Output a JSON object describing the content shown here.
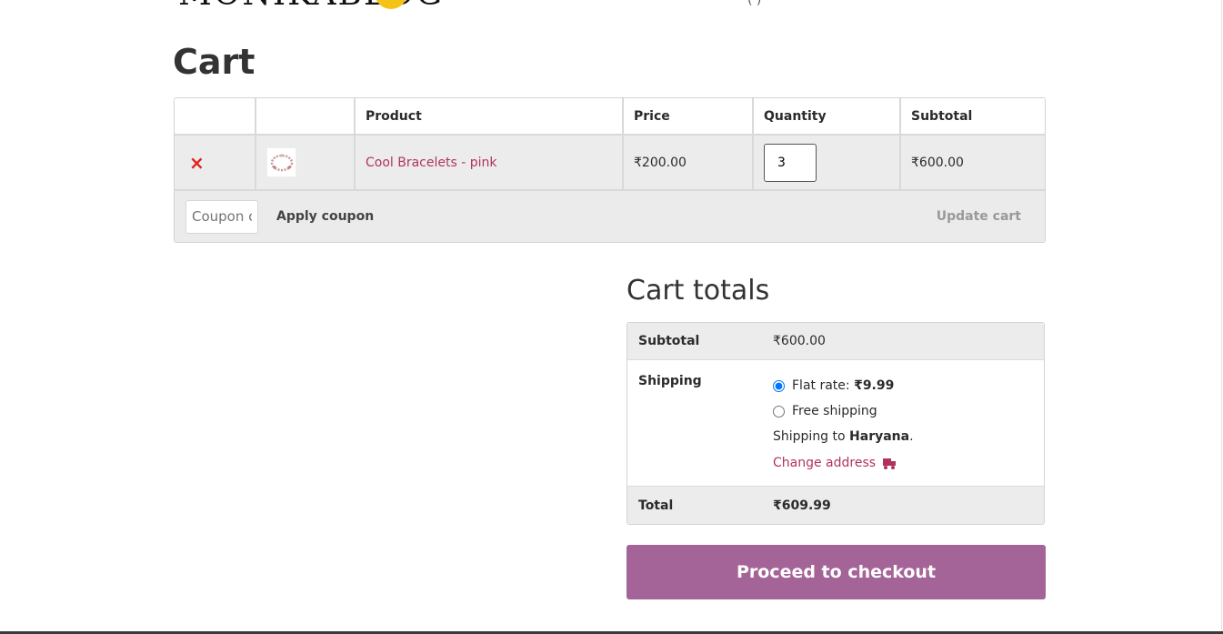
{
  "header": {
    "logo_text": "MONIKABLOG",
    "nav_fragment": "(    )"
  },
  "page_title": "Cart",
  "cart_table": {
    "columns": [
      "",
      "",
      "Product",
      "Price",
      "Quantity",
      "Subtotal"
    ],
    "items": [
      {
        "remove_symbol": "×",
        "product": "Cool Bracelets - pink",
        "price": "₹200.00",
        "quantity": "3",
        "subtotal": "₹600.00"
      }
    ],
    "coupon_placeholder": "Coupon code",
    "apply_coupon_label": "Apply coupon",
    "update_cart_label": "Update cart"
  },
  "totals": {
    "title": "Cart totals",
    "subtotal_label": "Subtotal",
    "subtotal_value": "₹600.00",
    "shipping_label": "Shipping",
    "shipping_options": [
      {
        "label": "Flat rate: ",
        "amount": "₹9.99",
        "selected": true
      },
      {
        "label": "Free shipping",
        "amount": "",
        "selected": false
      }
    ],
    "shipping_to_prefix": "Shipping to ",
    "shipping_region": "Haryana",
    "shipping_to_suffix": ".",
    "change_address_label": "Change address",
    "total_label": "Total",
    "total_value": "₹609.99"
  },
  "checkout_label": "Proceed to checkout",
  "colors": {
    "accent": "#a46497",
    "link": "#b0335f",
    "remove": "#e2211c",
    "row_bg": "#ececec"
  }
}
